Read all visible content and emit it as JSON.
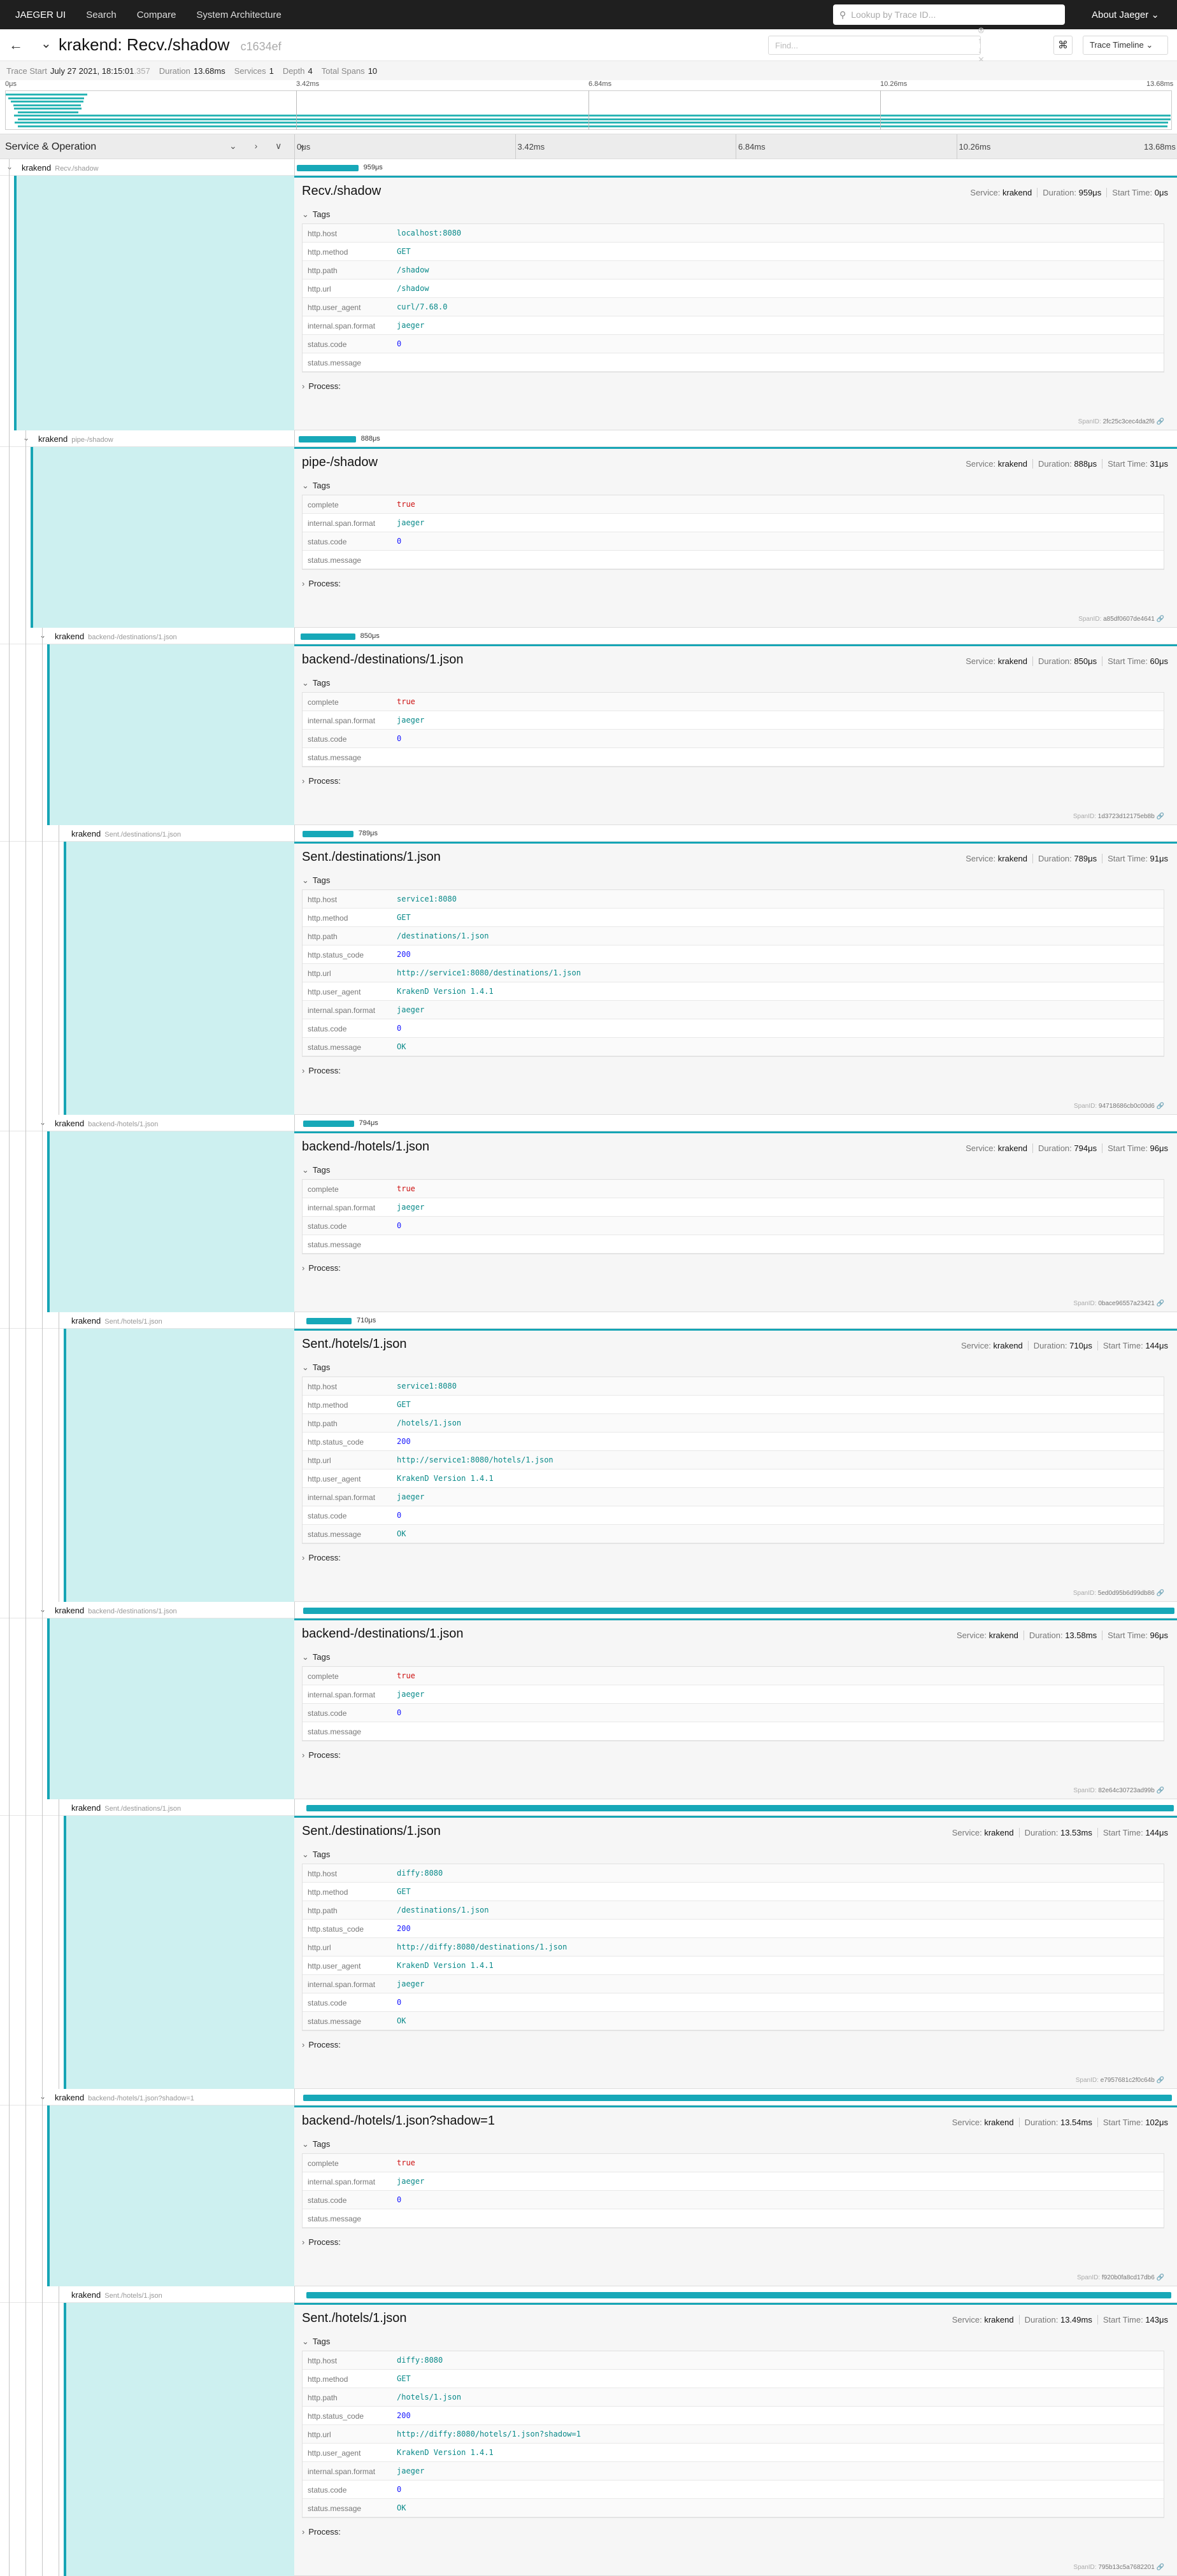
{
  "nav": {
    "brand": "JAEGER UI",
    "items": [
      "Search",
      "Compare",
      "System Architecture"
    ],
    "lookup_placeholder": "Lookup by Trace ID...",
    "about": "About Jaeger ⌄"
  },
  "trace": {
    "service": "krakend:",
    "operation": "Recv./shadow",
    "trace_id": "c1634ef",
    "find_placeholder": "Find...",
    "view": "Trace Timeline ⌄"
  },
  "meta": {
    "start_label": "Trace Start",
    "start": "July 27 2021, 18:15:01",
    "start_ms": ".357",
    "duration_label": "Duration",
    "duration": "13.68ms",
    "services_label": "Services",
    "services": "1",
    "depth_label": "Depth",
    "depth": "4",
    "spans_label": "Total Spans",
    "spans": "10"
  },
  "ticks": [
    "0μs",
    "3.42ms",
    "6.84ms",
    "10.26ms",
    "13.68ms"
  ],
  "header": {
    "service_operation": "Service & Operation"
  },
  "tag_section": "Tags",
  "process_section": "Process:",
  "labels": {
    "service": "Service:",
    "duration": "Duration:",
    "start": "Start Time:",
    "span_id": "SpanID:"
  },
  "spans": [
    {
      "svc": "krakend",
      "op": "Recv./shadow",
      "title": "Recv./shadow",
      "depth": 0,
      "duration": "959μs",
      "start": "0μs",
      "span_id": "2fc25c3cec4da2f6",
      "bar": [
        0.0,
        0.0701
      ],
      "tags": [
        [
          "http.host",
          "localhost:8080",
          "s"
        ],
        [
          "http.method",
          "GET",
          "s"
        ],
        [
          "http.path",
          "/shadow",
          "s"
        ],
        [
          "http.url",
          "/shadow",
          "s"
        ],
        [
          "http.user_agent",
          "curl/7.68.0",
          "s"
        ],
        [
          "internal.span.format",
          "jaeger",
          "s"
        ],
        [
          "status.code",
          "0",
          "n"
        ],
        [
          "status.message",
          "",
          ""
        ]
      ]
    },
    {
      "svc": "krakend",
      "op": "pipe-/shadow",
      "title": "pipe-/shadow",
      "depth": 1,
      "duration": "888μs",
      "start": "31μs",
      "span_id": "a85df0607de4641",
      "bar": [
        0.0023,
        0.0649
      ],
      "tags": [
        [
          "complete",
          "true",
          "b"
        ],
        [
          "internal.span.format",
          "jaeger",
          "s"
        ],
        [
          "status.code",
          "0",
          "n"
        ],
        [
          "status.message",
          "",
          ""
        ]
      ]
    },
    {
      "svc": "krakend",
      "op": "backend-/destinations/1.json",
      "title": "backend-/destinations/1.json",
      "depth": 2,
      "duration": "850μs",
      "start": "60μs",
      "span_id": "1d3723d12175eb8b",
      "bar": [
        0.0044,
        0.0621
      ],
      "tags": [
        [
          "complete",
          "true",
          "b"
        ],
        [
          "internal.span.format",
          "jaeger",
          "s"
        ],
        [
          "status.code",
          "0",
          "n"
        ],
        [
          "status.message",
          "",
          ""
        ]
      ]
    },
    {
      "svc": "krakend",
      "op": "Sent./destinations/1.json",
      "title": "Sent./destinations/1.json",
      "depth": 3,
      "duration": "789μs",
      "start": "91μs",
      "span_id": "94718686cb0c00d6",
      "bar": [
        0.0067,
        0.0577
      ],
      "tags": [
        [
          "http.host",
          "service1:8080",
          "s"
        ],
        [
          "http.method",
          "GET",
          "s"
        ],
        [
          "http.path",
          "/destinations/1.json",
          "s"
        ],
        [
          "http.status_code",
          "200",
          "n"
        ],
        [
          "http.url",
          "http://service1:8080/destinations/1.json",
          "s"
        ],
        [
          "http.user_agent",
          "KrakenD Version 1.4.1",
          "s"
        ],
        [
          "internal.span.format",
          "jaeger",
          "s"
        ],
        [
          "status.code",
          "0",
          "n"
        ],
        [
          "status.message",
          "OK",
          "s"
        ]
      ]
    },
    {
      "svc": "krakend",
      "op": "backend-/hotels/1.json",
      "title": "backend-/hotels/1.json",
      "depth": 2,
      "duration": "794μs",
      "start": "96μs",
      "span_id": "0bace96557a23421",
      "bar": [
        0.007,
        0.058
      ],
      "tags": [
        [
          "complete",
          "true",
          "b"
        ],
        [
          "internal.span.format",
          "jaeger",
          "s"
        ],
        [
          "status.code",
          "0",
          "n"
        ],
        [
          "status.message",
          "",
          ""
        ]
      ]
    },
    {
      "svc": "krakend",
      "op": "Sent./hotels/1.json",
      "title": "Sent./hotels/1.json",
      "depth": 3,
      "duration": "710μs",
      "start": "144μs",
      "span_id": "5ed0d95b6d99db86",
      "bar": [
        0.0105,
        0.0519
      ],
      "tags": [
        [
          "http.host",
          "service1:8080",
          "s"
        ],
        [
          "http.method",
          "GET",
          "s"
        ],
        [
          "http.path",
          "/hotels/1.json",
          "s"
        ],
        [
          "http.status_code",
          "200",
          "n"
        ],
        [
          "http.url",
          "http://service1:8080/hotels/1.json",
          "s"
        ],
        [
          "http.user_agent",
          "KrakenD Version 1.4.1",
          "s"
        ],
        [
          "internal.span.format",
          "jaeger",
          "s"
        ],
        [
          "status.code",
          "0",
          "n"
        ],
        [
          "status.message",
          "OK",
          "s"
        ]
      ]
    },
    {
      "svc": "krakend",
      "op": "backend-/destinations/1.json",
      "title": "backend-/destinations/1.json",
      "depth": 2,
      "duration": "13.58ms",
      "start": "96μs",
      "span_id": "82e64c30723ad99b",
      "bar": [
        0.007,
        0.9927
      ],
      "tags": [
        [
          "complete",
          "true",
          "b"
        ],
        [
          "internal.span.format",
          "jaeger",
          "s"
        ],
        [
          "status.code",
          "0",
          "n"
        ],
        [
          "status.message",
          "",
          ""
        ]
      ]
    },
    {
      "svc": "krakend",
      "op": "Sent./destinations/1.json",
      "title": "Sent./destinations/1.json",
      "depth": 3,
      "duration": "13.53ms",
      "start": "144μs",
      "span_id": "e7957681c2f0c64b",
      "bar": [
        0.0105,
        0.989
      ],
      "tags": [
        [
          "http.host",
          "diffy:8080",
          "s"
        ],
        [
          "http.method",
          "GET",
          "s"
        ],
        [
          "http.path",
          "/destinations/1.json",
          "s"
        ],
        [
          "http.status_code",
          "200",
          "n"
        ],
        [
          "http.url",
          "http://diffy:8080/destinations/1.json",
          "s"
        ],
        [
          "http.user_agent",
          "KrakenD Version 1.4.1",
          "s"
        ],
        [
          "internal.span.format",
          "jaeger",
          "s"
        ],
        [
          "status.code",
          "0",
          "n"
        ],
        [
          "status.message",
          "OK",
          "s"
        ]
      ]
    },
    {
      "svc": "krakend",
      "op": "backend-/hotels/1.json?shadow=1",
      "title": "backend-/hotels/1.json?shadow=1",
      "depth": 2,
      "duration": "13.54ms",
      "start": "102μs",
      "span_id": "f920b0fa8cd17db6",
      "bar": [
        0.0075,
        0.9898
      ],
      "tags": [
        [
          "complete",
          "true",
          "b"
        ],
        [
          "internal.span.format",
          "jaeger",
          "s"
        ],
        [
          "status.code",
          "0",
          "n"
        ],
        [
          "status.message",
          "",
          ""
        ]
      ]
    },
    {
      "svc": "krakend",
      "op": "Sent./hotels/1.json",
      "title": "Sent./hotels/1.json",
      "depth": 3,
      "duration": "13.49ms",
      "start": "143μs",
      "span_id": "795b13c5a7682201",
      "bar": [
        0.0105,
        0.9861
      ],
      "tags": [
        [
          "http.host",
          "diffy:8080",
          "s"
        ],
        [
          "http.method",
          "GET",
          "s"
        ],
        [
          "http.path",
          "/hotels/1.json",
          "s"
        ],
        [
          "http.status_code",
          "200",
          "n"
        ],
        [
          "http.url",
          "http://diffy:8080/hotels/1.json?shadow=1",
          "s"
        ],
        [
          "http.user_agent",
          "KrakenD Version 1.4.1",
          "s"
        ],
        [
          "internal.span.format",
          "jaeger",
          "s"
        ],
        [
          "status.code",
          "0",
          "n"
        ],
        [
          "status.message",
          "OK",
          "s"
        ]
      ]
    }
  ]
}
